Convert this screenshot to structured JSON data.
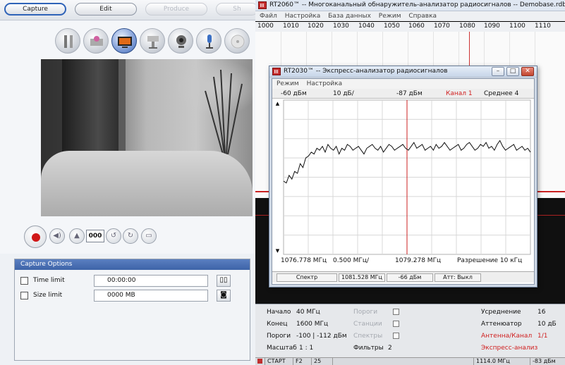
{
  "capture_app": {
    "tabs": [
      {
        "label": "Capture",
        "state": "active"
      },
      {
        "label": "Edit",
        "state": "normal"
      },
      {
        "label": "Produce",
        "state": "disabled"
      },
      {
        "label": "Sh",
        "state": "disabled"
      }
    ],
    "toolbar_icons": [
      "tools-icon",
      "effects-icon",
      "video-icon",
      "projector-icon",
      "webcam-icon",
      "microphone-icon",
      "disc-icon"
    ],
    "counter_value": "000",
    "capture_options": {
      "header": "Capture Options",
      "time_limit": {
        "label": "Time limit",
        "value": "00:00:00"
      },
      "size_limit": {
        "label": "Size limit",
        "value": "0000  MB"
      }
    }
  },
  "rt2060": {
    "title": "RT2060™ -- Многоканальный обнаружитель-анализатор радиосигналов -- Demobase.rdb",
    "menu": [
      "Файл",
      "Настройка",
      "База данных",
      "Режим",
      "Справка"
    ],
    "freq_ticks": [
      "1000",
      "1010",
      "1020",
      "1030",
      "1040",
      "1050",
      "1060",
      "1070",
      "1080",
      "1090",
      "1100",
      "1110"
    ],
    "panel": {
      "start_label": "Начало",
      "start_value": "40 МГц",
      "end_label": "Конец",
      "end_value": "1600 МГц",
      "thresholds_label": "Пороги",
      "thresholds_value": "-100 | -112 дБм",
      "scale_label": "Масштаб",
      "scale_value": "1 : 1",
      "opt_thresholds": "Пороги",
      "opt_stations": "Станции",
      "opt_spectra": "Спектры",
      "filters_label": "Фильтры",
      "filters_value": "2",
      "averaging_label": "Усреднение",
      "averaging_value": "16",
      "attenuator_label": "Аттенюатор",
      "attenuator_value": "10 дБ",
      "antenna_label": "Антенна/Канал",
      "antenna_value": "1/1",
      "express_label": "Экспресс-анализ"
    },
    "status": {
      "start": "СТАРТ",
      "key": "F2",
      "count": "25",
      "freq": "1114.0 МГц",
      "level": "-83 дБм"
    }
  },
  "rt2030": {
    "title": "RT2030™ -- Экспресс-анализатор радиосигналов",
    "menu": [
      "Режим",
      "Настройка"
    ],
    "info": {
      "ref_level": "-60 дБм",
      "div": "10 дБ/",
      "marker_level": "-87 дБм",
      "channel": "Канал 1",
      "average": "Среднее  4"
    },
    "freq": {
      "start": "1076.778 МГц",
      "span": "0.500 МГц/",
      "center": "1079.278 МГц",
      "resolution": "Разрешение  10 кГц"
    },
    "status": {
      "mode": "Спектр",
      "marker_freq": "1081.528 МГц",
      "marker_level": "-66 дБм",
      "attenuator": "Атт: Выкл"
    }
  },
  "chart_data": {
    "type": "line",
    "x_range": [
      1076.778,
      1081.778
    ],
    "y_range": [
      -140,
      -60
    ],
    "grid": true,
    "marker_x": 1079.278,
    "series": [
      {
        "values": [
          -102,
          -103,
          -99,
          -101,
          -97,
          -98,
          -93,
          -95,
          -90,
          -89,
          -87,
          -88,
          -85,
          -86,
          -84,
          -87,
          -83,
          -85,
          -86,
          -84,
          -88,
          -85,
          -86,
          -83,
          -84,
          -86,
          -85,
          -84,
          -86,
          -88,
          -85,
          -84,
          -83,
          -85,
          -86,
          -84,
          -87,
          -85,
          -83,
          -84,
          -86,
          -85,
          -84,
          -83,
          -85,
          -86,
          -84,
          -82,
          -85,
          -84,
          -83,
          -86,
          -85,
          -84,
          -86,
          -83,
          -85,
          -84,
          -82,
          -84,
          -86,
          -85,
          -84,
          -83,
          -86,
          -85,
          -83,
          -82,
          -84,
          -86,
          -85,
          -83,
          -84,
          -82,
          -85,
          -84,
          -86,
          -83,
          -81,
          -84,
          -86,
          -85,
          -84,
          -83,
          -86,
          -85,
          -84,
          -86,
          -85,
          -87
        ]
      }
    ]
  }
}
